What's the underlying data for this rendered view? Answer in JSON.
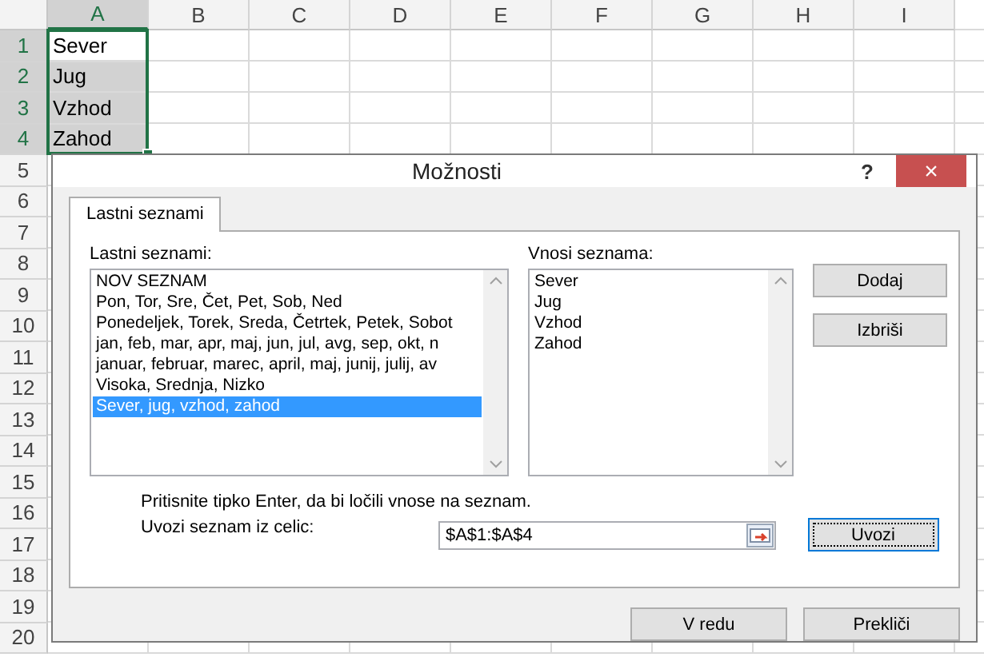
{
  "sheet": {
    "columns": [
      {
        "label": "A",
        "selected": true
      },
      {
        "label": "B",
        "selected": false
      },
      {
        "label": "C",
        "selected": false
      },
      {
        "label": "D",
        "selected": false
      },
      {
        "label": "E",
        "selected": false
      },
      {
        "label": "F",
        "selected": false
      },
      {
        "label": "G",
        "selected": false
      },
      {
        "label": "H",
        "selected": false
      },
      {
        "label": "I",
        "selected": false
      }
    ],
    "rows": [
      {
        "label": "1",
        "selected": true,
        "cells": [
          {
            "text": "Sever",
            "selected": false
          }
        ]
      },
      {
        "label": "2",
        "selected": true,
        "cells": [
          {
            "text": "Jug",
            "selected": true
          }
        ]
      },
      {
        "label": "3",
        "selected": true,
        "cells": [
          {
            "text": "Vzhod",
            "selected": true
          }
        ]
      },
      {
        "label": "4",
        "selected": true,
        "cells": [
          {
            "text": "Zahod",
            "selected": true
          }
        ]
      },
      {
        "label": "5",
        "selected": false
      },
      {
        "label": "6",
        "selected": false
      },
      {
        "label": "7",
        "selected": false
      },
      {
        "label": "8",
        "selected": false
      },
      {
        "label": "9",
        "selected": false
      },
      {
        "label": "10",
        "selected": false
      },
      {
        "label": "11",
        "selected": false
      },
      {
        "label": "12",
        "selected": false
      },
      {
        "label": "13",
        "selected": false
      },
      {
        "label": "14",
        "selected": false
      },
      {
        "label": "15",
        "selected": false
      },
      {
        "label": "16",
        "selected": false
      },
      {
        "label": "17",
        "selected": false
      },
      {
        "label": "18",
        "selected": false
      },
      {
        "label": "19",
        "selected": false
      },
      {
        "label": "20",
        "selected": false
      }
    ]
  },
  "dialog": {
    "title": "Možnosti",
    "help": "?",
    "close": "×",
    "tabs": [
      {
        "label": "Lastni seznami",
        "selected": true
      }
    ],
    "custom_lists": {
      "label": "Lastni seznami:",
      "items": [
        {
          "text": "NOV SEZNAM",
          "selected": false
        },
        {
          "text": "Pon, Tor, Sre, Čet, Pet, Sob, Ned",
          "selected": false
        },
        {
          "text": "Ponedeljek, Torek, Sreda, Četrtek, Petek, Sobot",
          "selected": false
        },
        {
          "text": "jan, feb, mar, apr, maj, jun, jul, avg, sep, okt, n",
          "selected": false
        },
        {
          "text": "januar, februar, marec, april, maj, junij, julij, av",
          "selected": false
        },
        {
          "text": "Visoka, Srednja, Nizko",
          "selected": false
        },
        {
          "text": "Sever, jug, vzhod, zahod",
          "selected": true
        }
      ]
    },
    "list_entries": {
      "label": "Vnosi seznama:",
      "lines": [
        "Sever",
        "Jug",
        "Vzhod",
        "Zahod"
      ]
    },
    "side_buttons": [
      "Dodaj",
      "Izbriši"
    ],
    "hint": "Pritisnite tipko Enter, da bi ločili vnose na seznam.",
    "import": {
      "label": "Uvozi seznam iz celic:",
      "value": "$A$1:$A$4",
      "button": "Uvozi"
    },
    "buttons": [
      "V redu",
      "Prekliči"
    ]
  }
}
